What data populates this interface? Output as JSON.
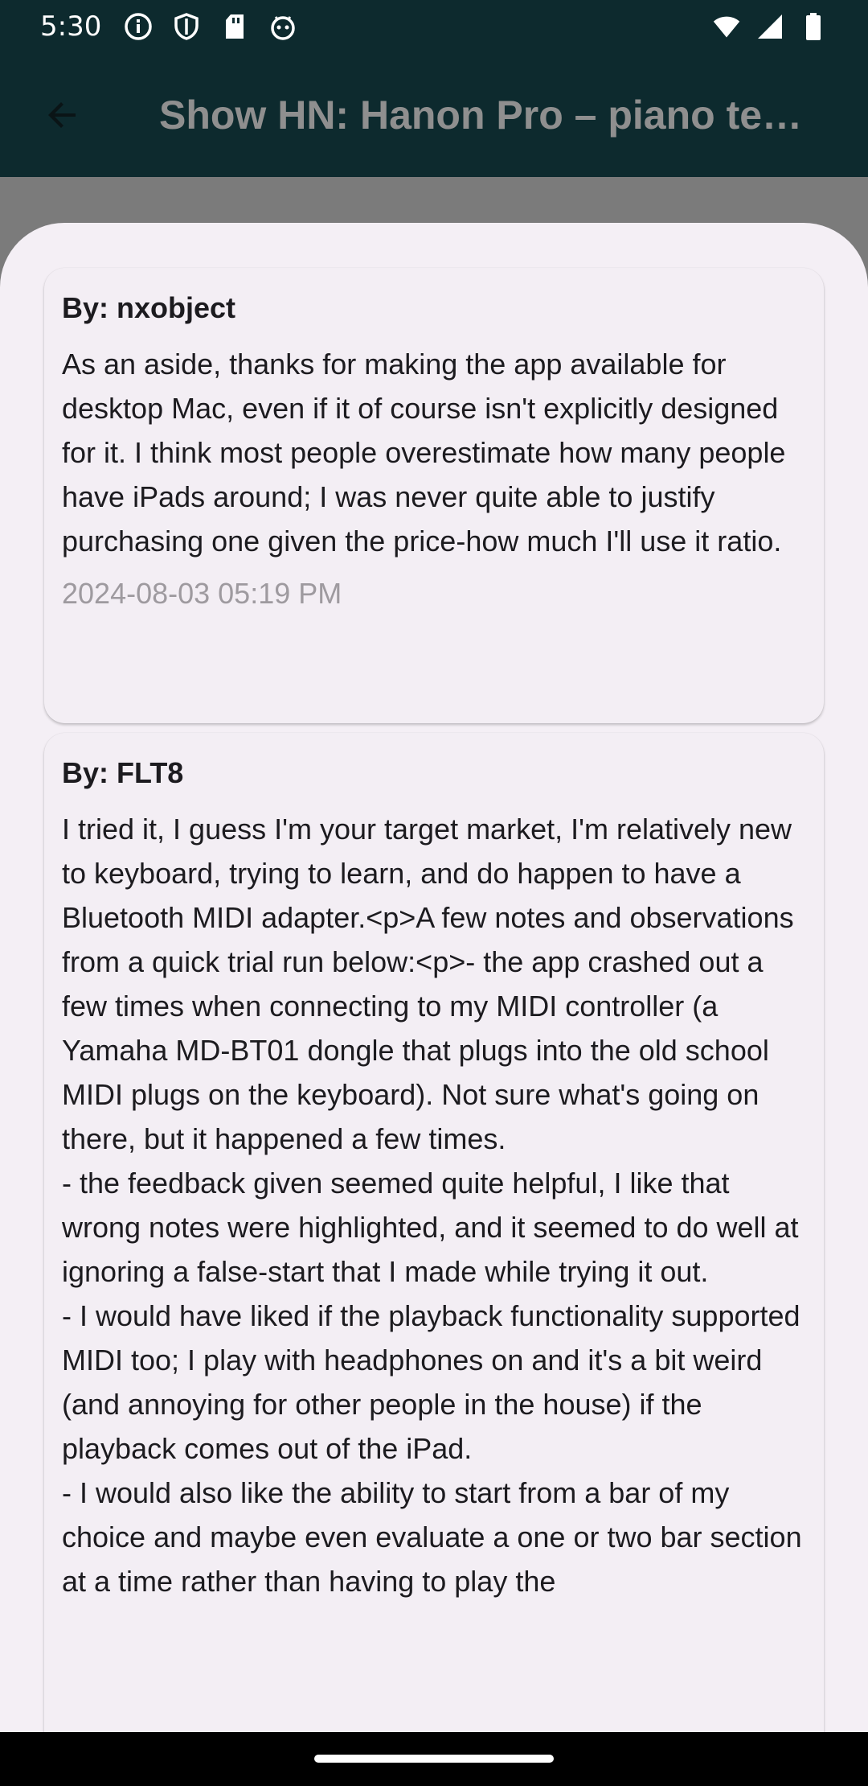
{
  "status_bar": {
    "time": "5:30",
    "left_icons": [
      "info-icon",
      "shield-icon",
      "sd-card-icon",
      "android-debug-icon"
    ],
    "right_icons": [
      "wifi-icon",
      "cell-signal-icon",
      "battery-icon"
    ]
  },
  "app_bar": {
    "back_icon": "arrow-back-icon",
    "title": "Show HN: Hanon Pro – piano te…"
  },
  "comments": [
    {
      "author": "By: nxobject",
      "text": "As an aside, thanks for making the app available for desktop Mac, even if it of course isn't explicitly designed for it. I think most people overestimate how many people have iPads around; I was never quite able to justify purchasing one given the price-how much I'll use it ratio.",
      "date": "2024-08-03 05:19 PM"
    },
    {
      "author": "By: FLT8",
      "text": "I tried it, I guess I'm your target market, I'm relatively new to keyboard, trying to learn, and do happen to have a Bluetooth MIDI adapter.<p>A few notes and observations from a quick trial run below:<p>- the app crashed out a few times when connecting to my MIDI controller (a Yamaha MD-BT01 dongle that plugs into the old school MIDI plugs on the keyboard). Not sure what's going on there, but it happened a few times.\n- the feedback given seemed quite helpful, I like that wrong notes were highlighted, and it seemed to do well at ignoring a false-start that I made while trying it out.\n- I would have liked if the playback functionality supported MIDI too; I play with headphones on and it's a bit weird (and annoying for other people in the house) if the playback comes out of the iPad.\n- I would also like the ability to start from a bar of my choice and maybe even evaluate a one or two bar section at a time rather than having to play the"
    }
  ],
  "colors": {
    "app_bar_bg": "#0d2a2e",
    "sheet_bg": "#f4eff5",
    "title_text": "#8f8f8f",
    "date_text": "#9e9a9f"
  }
}
